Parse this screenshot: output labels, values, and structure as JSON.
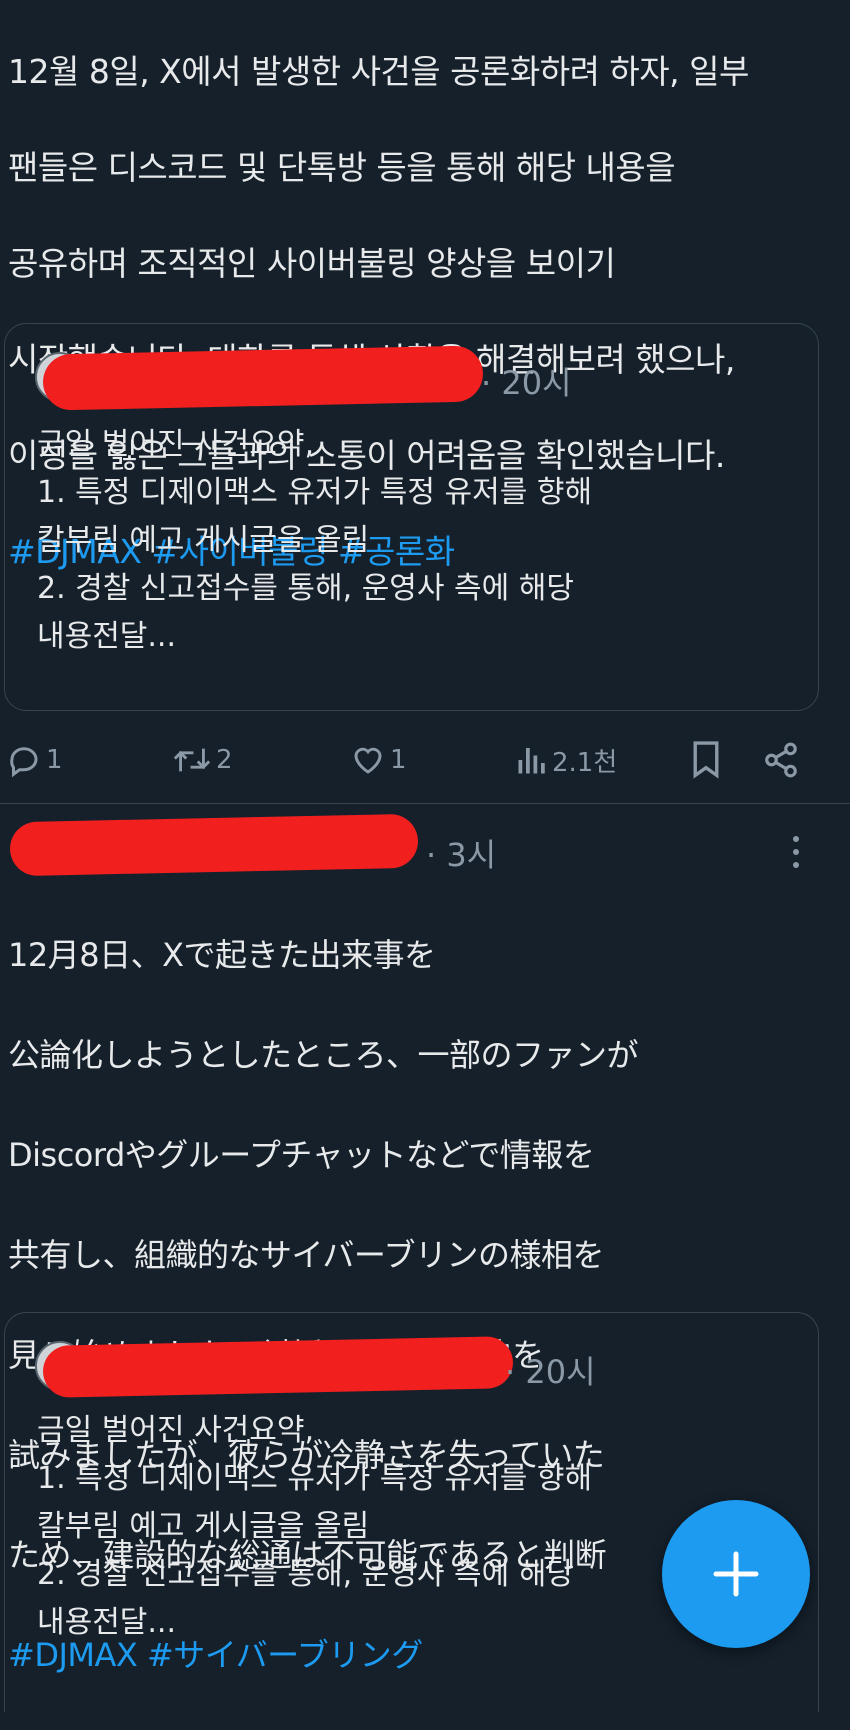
{
  "tweet1": {
    "text_lines": [
      "12월 8일, X에서 발생한 사건을 공론화하려 하자, 일부",
      "팬들은 디스코드 및 단톡방 등을 통해 해당 내용을",
      "공유하며 조직적인 사이버불링 양상을 보이기",
      "시작했습니다. 대화를 통해 상황을 해결해보려 했으나,",
      "이성을 잃은 그들과의 소통이 어려움을 확인했습니다."
    ],
    "hashtags": "#DJMAX #사이버불링 #공론화",
    "quote": {
      "time": "· 20시",
      "lines": [
        "금일 벌어진 사건요약,",
        "1. 특정 디제이맥스 유저가 특정 유저를 향해",
        "칼부림 예고 게시글을 올림",
        "2. 경찰 신고접수를 통해, 운영사 측에 해당",
        "내용전달..."
      ]
    },
    "actions": {
      "replies": "1",
      "retweets": "2",
      "likes": "1",
      "views": "2.1천"
    }
  },
  "tweet2": {
    "time": "· 3시",
    "text_lines": [
      "12月8日、Xで起きた出来事を",
      "公論化しようとしたところ、一部のファンが",
      "Discordやグループチャットなどで情報を",
      "共有し、組織的なサイバーブリンの様相を",
      "見せ始めました。対話を通じて解決を",
      "試みましたが、彼らが冷静さを失っていた",
      "ため、建設的な総通は不可能であると判断"
    ],
    "hashtags": "#DJMAX #サイバーブリング",
    "quote": {
      "time": "· 20시",
      "lines": [
        "금일 벌어진 사건요약,",
        "1. 특정 디제이맥스 유저가 특정 유저를 향해",
        "칼부림 예고 게시글을 올림",
        "2. 경찰 신고접수를 통해, 운영사 측에 해당",
        "내용전달..."
      ]
    }
  },
  "colors": {
    "background": "#15202b",
    "text": "#e7e9ea",
    "secondary": "#8b98a5",
    "accent": "#1d9bf0",
    "border": "#38444d",
    "redaction": "#f21f1f"
  },
  "icons": {
    "reply": "reply-icon",
    "retweet": "retweet-icon",
    "like": "heart-icon",
    "views": "views-icon",
    "bookmark": "bookmark-icon",
    "share": "share-icon",
    "more": "more-icon",
    "compose": "plus-icon"
  }
}
